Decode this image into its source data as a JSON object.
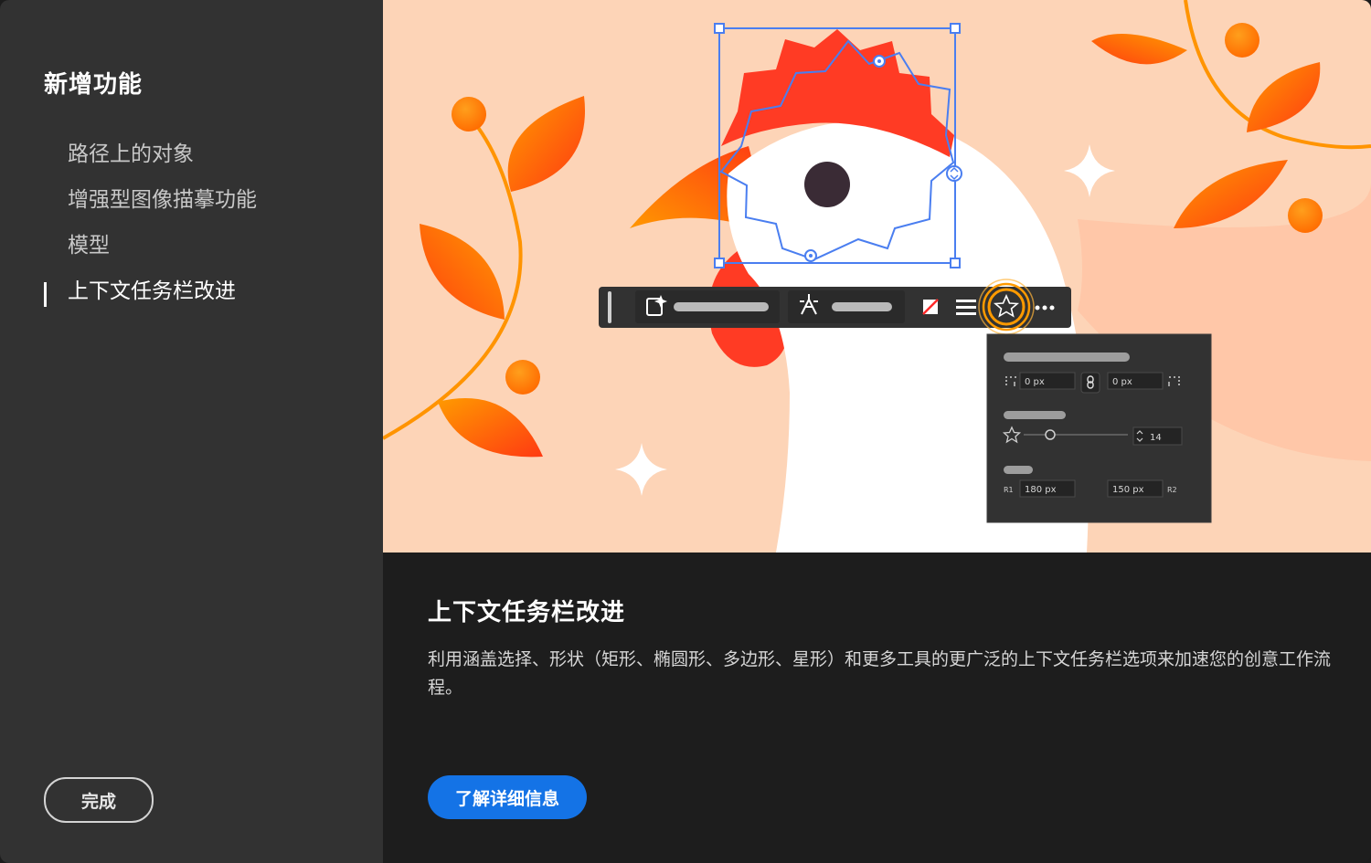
{
  "sidebar": {
    "title": "新增功能",
    "items": [
      {
        "label": "路径上的对象",
        "active": false
      },
      {
        "label": "增强型图像描摹功能",
        "active": false
      },
      {
        "label": "模型",
        "active": false
      },
      {
        "label": "上下文任务栏改进",
        "active": true
      }
    ],
    "done_label": "完成"
  },
  "hero": {
    "panel": {
      "offset_left": "0 px",
      "offset_right": "0 px",
      "points": "14",
      "r1_label": "R1",
      "r1_value": "180 px",
      "r2_label": "R2",
      "r2_value": "150 px"
    }
  },
  "content": {
    "title": "上下文任务栏改进",
    "description": "利用涵盖选择、形状（矩形、椭圆形、多边形、星形）和更多工具的更广泛的上下文任务栏选项来加速您的创意工作流程。",
    "learn_more_label": "了解详细信息"
  },
  "colors": {
    "sidebar_bg": "#323232",
    "content_bg": "#1d1d1d",
    "hero_bg": "#fdd4b7",
    "accent_blue": "#1473e6",
    "selection_blue": "#4a7ef0",
    "comb_red": "#ff3b24",
    "leaf_orange": "#ff8a00"
  }
}
